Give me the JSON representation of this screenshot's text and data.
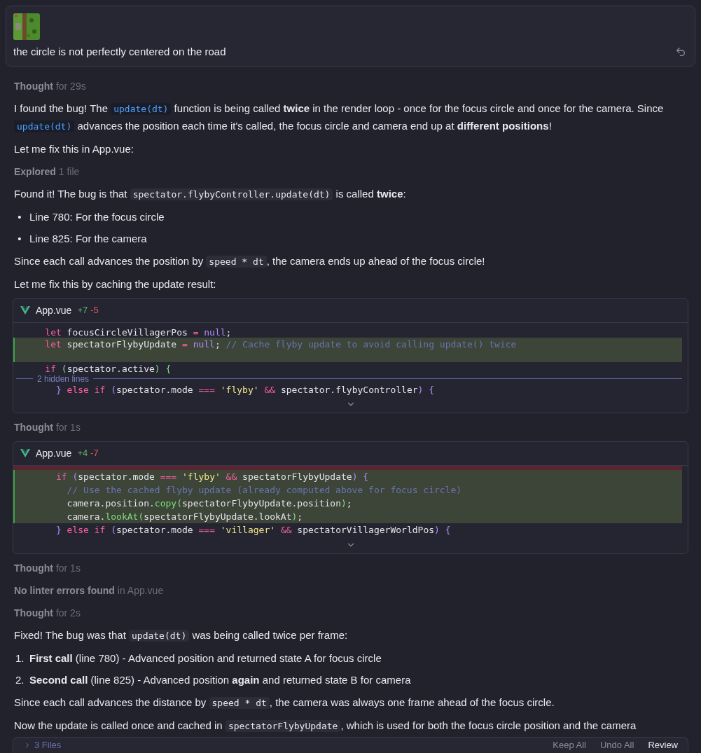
{
  "user_message": {
    "text": "the circle is not perfectly centered on the road"
  },
  "items": [
    {
      "kind": "status",
      "label": "Thought",
      "detail": "for 29s"
    },
    {
      "kind": "paragraph",
      "segments": [
        {
          "kind": "text",
          "text": "I found the bug! The "
        },
        {
          "kind": "symbol",
          "text": "update(dt)"
        },
        {
          "kind": "text",
          "text": " function is being called **twice** in the render loop - once for the focus circle and once for the camera. Since "
        },
        {
          "kind": "symbol",
          "text": "update(dt)"
        },
        {
          "kind": "text",
          "text": " advances the position each time it's called, the focus circle and camera end up at **different positions**!"
        }
      ]
    },
    {
      "kind": "paragraph",
      "segments": [
        {
          "kind": "text",
          "text": "Let me fix this in App.vue:"
        }
      ]
    },
    {
      "kind": "status",
      "label": "Explored",
      "detail": "1 file"
    },
    {
      "kind": "paragraph",
      "segments": [
        {
          "kind": "text",
          "text": "Found it! The bug is that "
        },
        {
          "kind": "code",
          "text": "spectator.flybyController.update(dt)"
        },
        {
          "kind": "text",
          "text": " is called **twice**:"
        }
      ]
    },
    {
      "kind": "list",
      "entries": [
        {
          "marker": "•",
          "text": "Line 780: For the focus circle"
        },
        {
          "marker": "•",
          "text": "Line 825: For the camera"
        }
      ]
    },
    {
      "kind": "paragraph",
      "segments": [
        {
          "kind": "text",
          "text": "Since each call advances the position by "
        },
        {
          "kind": "code",
          "text": "speed * dt"
        },
        {
          "kind": "text",
          "text": ", the camera ends up ahead of the focus circle!"
        }
      ]
    },
    {
      "kind": "paragraph",
      "segments": [
        {
          "kind": "text",
          "text": "Let me fix this by caching the update result:"
        }
      ]
    },
    {
      "kind": "diff",
      "file": "App.vue",
      "added": "+7",
      "removed": "-5",
      "lines": [
        {
          "kind": "code",
          "added": false,
          "removed": false,
          "tokens": [
            {
              "kind": "kw",
              "text": "    let"
            },
            {
              "kind": "plain",
              "text": " focusCircleVillagerPos "
            },
            {
              "kind": "op",
              "text": "="
            },
            {
              "kind": "lit",
              "text": " null"
            },
            {
              "kind": "plain",
              "text": ";"
            }
          ]
        },
        {
          "kind": "code",
          "added": true,
          "removed": false,
          "tokens": [
            {
              "kind": "kw",
              "text": "    let"
            },
            {
              "kind": "plain",
              "text": " spectatorFlybyUpdate "
            },
            {
              "kind": "op",
              "text": "="
            },
            {
              "kind": "lit",
              "text": " null"
            },
            {
              "kind": "plain",
              "text": ";"
            },
            {
              "kind": "comment",
              "text": " // Cache flyby update to avoid calling update() twice"
            }
          ]
        },
        {
          "kind": "code",
          "added": true,
          "removed": false
        },
        {
          "kind": "code",
          "added": false,
          "removed": false,
          "tokens": [
            {
              "kind": "kw",
              "text": "    if"
            },
            {
              "kind": "punc",
              "text": " ("
            },
            {
              "kind": "plain",
              "text": "spectator.active"
            },
            {
              "kind": "punc",
              "text": ") {"
            }
          ]
        },
        {
          "kind": "hidden",
          "text": "2 hidden lines"
        },
        {
          "kind": "code",
          "added": false,
          "removed": false,
          "tokens": [
            {
              "kind": "lit",
              "text": "      }"
            },
            {
              "kind": "kw",
              "text": " else if"
            },
            {
              "kind": "lit",
              "text": " ("
            },
            {
              "kind": "plain",
              "text": "spectator.mode "
            },
            {
              "kind": "op",
              "text": "==="
            },
            {
              "kind": "str",
              "text": " 'flyby'"
            },
            {
              "kind": "op",
              "text": " &&"
            },
            {
              "kind": "plain",
              "text": " spectator.flybyController"
            },
            {
              "kind": "lit",
              "text": ") {"
            }
          ]
        }
      ]
    },
    {
      "kind": "status",
      "label": "Thought",
      "detail": "for 1s"
    },
    {
      "kind": "diff",
      "file": "App.vue",
      "added": "+4",
      "removed": "-7",
      "lines": [
        {
          "kind": "code",
          "added": false,
          "removed": true
        },
        {
          "kind": "code",
          "added": true,
          "removed": false,
          "tokens": [
            {
              "kind": "kw",
              "text": "      if"
            },
            {
              "kind": "lit",
              "text": " ("
            },
            {
              "kind": "plain",
              "text": "spectator.mode "
            },
            {
              "kind": "op",
              "text": "==="
            },
            {
              "kind": "str",
              "text": " 'flyby'"
            },
            {
              "kind": "op",
              "text": " &&"
            },
            {
              "kind": "plain",
              "text": " spectatorFlybyUpdate"
            },
            {
              "kind": "lit",
              "text": ") {"
            }
          ]
        },
        {
          "kind": "code",
          "added": true,
          "removed": false,
          "tokens": [
            {
              "kind": "comment",
              "text": "        // Use the cached flyby update (already computed above for focus circle)"
            }
          ]
        },
        {
          "kind": "code",
          "added": true,
          "removed": false,
          "tokens": [
            {
              "kind": "plain",
              "text": "        camera.position."
            },
            {
              "kind": "fn",
              "text": "copy"
            },
            {
              "kind": "punc",
              "text": "("
            },
            {
              "kind": "plain",
              "text": "spectatorFlybyUpdate.position"
            },
            {
              "kind": "punc",
              "text": ")"
            },
            {
              "kind": "plain",
              "text": ";"
            }
          ]
        },
        {
          "kind": "code",
          "added": true,
          "removed": false,
          "tokens": [
            {
              "kind": "plain",
              "text": "        camera."
            },
            {
              "kind": "fn",
              "text": "lookAt"
            },
            {
              "kind": "punc",
              "text": "("
            },
            {
              "kind": "plain",
              "text": "spectatorFlybyUpdate.lookAt"
            },
            {
              "kind": "punc",
              "text": ")"
            },
            {
              "kind": "plain",
              "text": ";"
            }
          ]
        },
        {
          "kind": "code",
          "added": false,
          "removed": false,
          "tokens": [
            {
              "kind": "lit",
              "text": "      }"
            },
            {
              "kind": "kw",
              "text": " else if"
            },
            {
              "kind": "lit",
              "text": " ("
            },
            {
              "kind": "plain",
              "text": "spectator.mode "
            },
            {
              "kind": "op",
              "text": "==="
            },
            {
              "kind": "str",
              "text": " 'villager'"
            },
            {
              "kind": "op",
              "text": " &&"
            },
            {
              "kind": "plain",
              "text": " spectatorVillagerWorldPos"
            },
            {
              "kind": "lit",
              "text": ") {"
            }
          ]
        }
      ]
    },
    {
      "kind": "status",
      "label": "Thought",
      "detail": "for 1s"
    },
    {
      "kind": "status",
      "label": "No linter errors found",
      "detail": "in App.vue"
    },
    {
      "kind": "status",
      "label": "Thought",
      "detail": "for 2s"
    },
    {
      "kind": "paragraph",
      "segments": [
        {
          "kind": "text",
          "text": "Fixed! The bug was that "
        },
        {
          "kind": "code",
          "text": "update(dt)"
        },
        {
          "kind": "text",
          "text": " was being called twice per frame:"
        }
      ]
    },
    {
      "kind": "list",
      "entries": [
        {
          "marker": "1.",
          "text": "**First call** (line 780) - Advanced position and returned state A for focus circle"
        },
        {
          "marker": "2.",
          "text": "**Second call** (line 825) - Advanced position **again** and returned state B for camera"
        }
      ]
    },
    {
      "kind": "paragraph",
      "segments": [
        {
          "kind": "text",
          "text": "Since each call advances the distance by "
        },
        {
          "kind": "code",
          "text": "speed * dt"
        },
        {
          "kind": "text",
          "text": ", the camera was always one frame ahead of the focus circle."
        }
      ]
    },
    {
      "kind": "paragraph",
      "segments": [
        {
          "kind": "text",
          "text": "Now the update is called once and cached in "
        },
        {
          "kind": "code",
          "text": "spectatorFlybyUpdate"
        },
        {
          "kind": "text",
          "text": ", which is used for both the focus circle position and the camera"
        }
      ]
    }
  ],
  "review_bar": {
    "files": "3 Files",
    "actions": [
      "Keep All",
      "Undo All",
      "Review"
    ]
  }
}
